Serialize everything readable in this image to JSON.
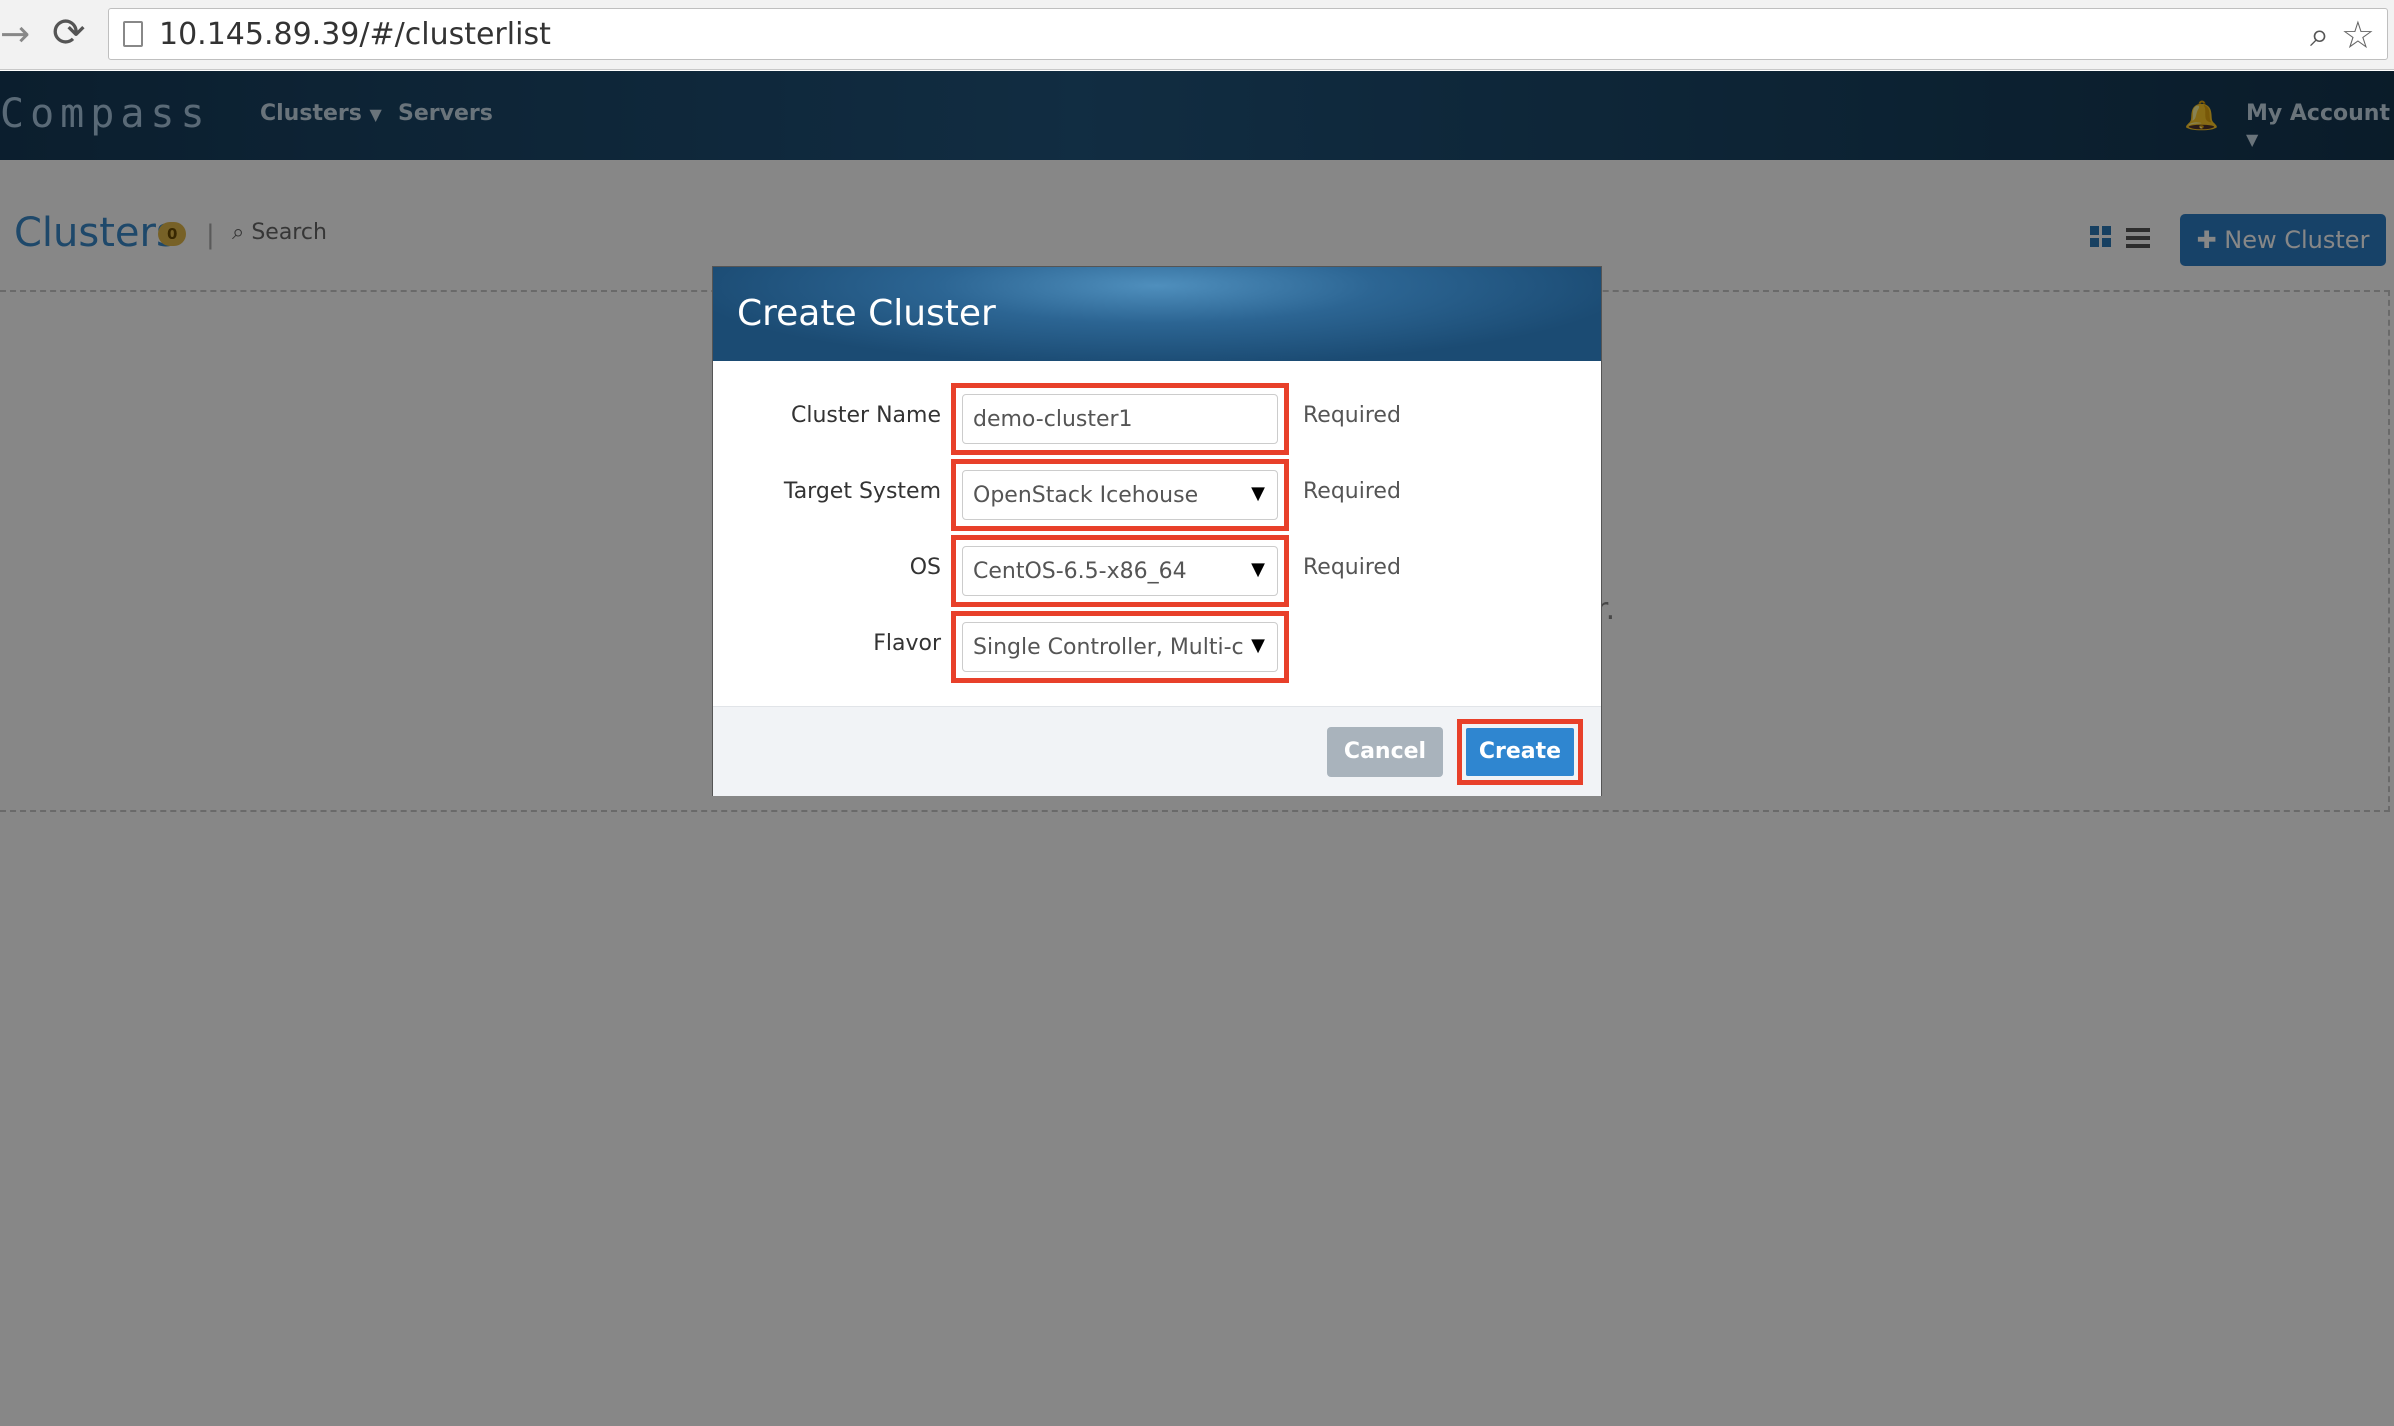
{
  "browser": {
    "url": "10.145.89.39/#/clusterlist"
  },
  "header": {
    "logo": "Compass",
    "nav": {
      "clusters": "Clusters",
      "servers": "Servers"
    },
    "account": "My Account"
  },
  "page": {
    "title": "Clusters",
    "count": "0",
    "search": "Search",
    "new_cluster": "New Cluster",
    "partial_text": "r."
  },
  "modal": {
    "title": "Create Cluster",
    "fields": {
      "cluster_name": {
        "label": "Cluster Name",
        "value": "demo-cluster1",
        "note": "Required"
      },
      "target_system": {
        "label": "Target System",
        "value": "OpenStack Icehouse",
        "note": "Required"
      },
      "os": {
        "label": "OS",
        "value": "CentOS-6.5-x86_64",
        "note": "Required"
      },
      "flavor": {
        "label": "Flavor",
        "value": "Single Controller, Multi-c"
      }
    },
    "buttons": {
      "cancel": "Cancel",
      "create": "Create"
    }
  },
  "colors": {
    "accent": "#2d7ec4",
    "highlight": "#e8402a",
    "header": "#1b4b73"
  }
}
